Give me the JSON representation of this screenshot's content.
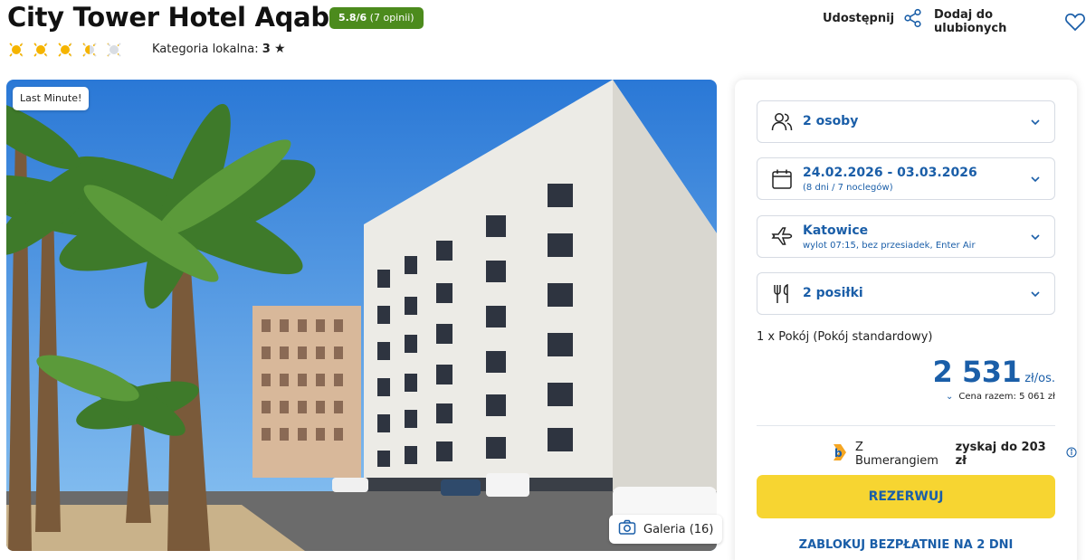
{
  "hotel": {
    "name": "City Tower Hotel Aqaba",
    "rating_score": "5.8/6",
    "rating_reviews": "(7 opinii)",
    "sun_rating": 3.5,
    "sun_max": 5,
    "local_category_label": "Kategoria lokalna:",
    "local_category_value": "3"
  },
  "header_actions": {
    "share_label": "Udostępnij",
    "favorite_label": "Dodaj do ulubionych"
  },
  "photo": {
    "badge": "Last Minute!",
    "gallery_label": "Galeria (16)"
  },
  "booking": {
    "guests": "2 osoby",
    "dates": "24.02.2026 - 03.03.2026",
    "dates_sub": "(8 dni / 7 noclegów)",
    "departure_city": "Katowice",
    "departure_sub": "wylot 07:15, bez przesiadek, Enter Air",
    "meals": "2 posiłki",
    "room": "1 x Pokój  (Pokój standardowy)",
    "price_amount": "2 531",
    "price_unit": "zł/os.",
    "total_price": "Cena razem: 5 061 zł",
    "bumerang_prefix": "Z Bumerangiem",
    "bumerang_bold": "zyskaj do 203 zł",
    "reserve_label": "REZERWUJ",
    "block_label": "ZABLOKUJ BEZPŁATNIE NA 2 DNI"
  },
  "colors": {
    "accent_blue": "#1a5ea8",
    "rating_green": "#4c8b1d",
    "reserve_yellow": "#f7d531",
    "sun_orange": "#f5b400"
  }
}
